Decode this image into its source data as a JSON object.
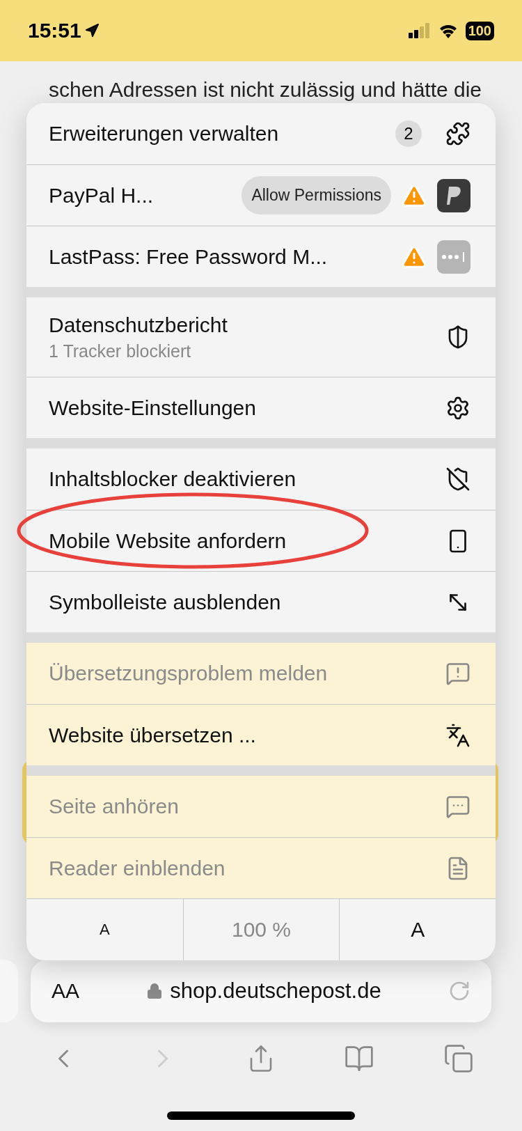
{
  "status_bar": {
    "time": "15:51",
    "battery": "100"
  },
  "page": {
    "text_line": "schen Adressen ist nicht zulässig und hätte die"
  },
  "menu": {
    "sections": [
      {
        "items": [
          {
            "kind": "extension",
            "label": "Erweiterungen verwalten",
            "badge": "2",
            "warning": false,
            "disabled": false,
            "circled": false
          },
          {
            "kind": "extension",
            "label": "PayPal H...",
            "button": "Allow Permissions",
            "warning": true,
            "disabled": false,
            "circled": false
          },
          {
            "kind": "extension",
            "label": "LastPass: Free Password M...",
            "warning": true,
            "disabled": false,
            "circled": false
          }
        ]
      },
      {
        "items": [
          {
            "kind": "action",
            "label": "Datenschutzbericht",
            "subtitle": "1 Tracker blockiert",
            "disabled": false,
            "circled": false
          },
          {
            "kind": "action",
            "label": "Website-Einstellungen",
            "disabled": false,
            "circled": false
          }
        ]
      },
      {
        "items": [
          {
            "kind": "action",
            "label": "Inhaltsblocker deaktivieren",
            "disabled": false,
            "circled": false
          },
          {
            "kind": "action",
            "label": "Mobile Website anfordern",
            "disabled": false,
            "circled": true
          },
          {
            "kind": "action",
            "label": "Symbolleiste ausblenden",
            "disabled": false,
            "circled": false
          }
        ]
      },
      {
        "items": [
          {
            "kind": "action",
            "label": "Übersetzungsproblem melden",
            "disabled": true,
            "circled": false
          },
          {
            "kind": "action",
            "label": "Website übersetzen ...",
            "disabled": false,
            "circled": false
          }
        ]
      },
      {
        "items": [
          {
            "kind": "action",
            "label": "Seite anhören",
            "disabled": true,
            "circled": false
          },
          {
            "kind": "action",
            "label": "Reader einblenden",
            "disabled": true,
            "circled": false
          }
        ]
      }
    ],
    "zoom": {
      "smaller": "A",
      "level": "100 %",
      "larger": "A"
    }
  },
  "address_bar": {
    "text_size": "AA",
    "url": "shop.deutschepost.de"
  }
}
